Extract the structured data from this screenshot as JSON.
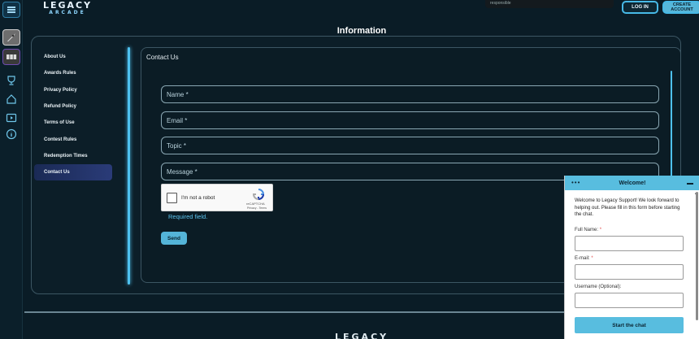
{
  "header": {
    "logo_top": "LEGACY",
    "logo_bottom": "ARCADE",
    "notif_text": "responsible",
    "login_label": "LOG IN",
    "create_label_1": "CREATE",
    "create_label_2": "ACCOUNT"
  },
  "page": {
    "title": "Information"
  },
  "nav": {
    "items": [
      "About Us",
      "Awards Rules",
      "Privacy Policy",
      "Refund Policy",
      "Terms of Use",
      "Contest Rules",
      "Redemption Times",
      "Contact Us"
    ],
    "active": "Contact Us"
  },
  "contact": {
    "title": "Contact Us",
    "fields": {
      "name": "Name *",
      "email": "Email *",
      "topic": "Topic *",
      "message": "Message *"
    },
    "captcha": {
      "label": "I'm not a robot",
      "brand": "reCAPTCHA",
      "links": "Privacy - Terms"
    },
    "required_text": "Required field.",
    "send_label": "Send"
  },
  "footer": {
    "logo": "LEGACY"
  },
  "chat": {
    "title": "Welcome!",
    "dots": "•••",
    "intro": "Welcome to Legacy Support! We look forward to helping out. Please fill in this form before starting the chat.",
    "full_name_label": "Full Name:",
    "email_label": "E-mail:",
    "username_label": "Username (Optional):",
    "start_label": "Start the chat",
    "required_mark": "*"
  },
  "colors": {
    "accent": "#4ec1ef",
    "background": "#0a1c26",
    "button": "#54b4d8"
  }
}
